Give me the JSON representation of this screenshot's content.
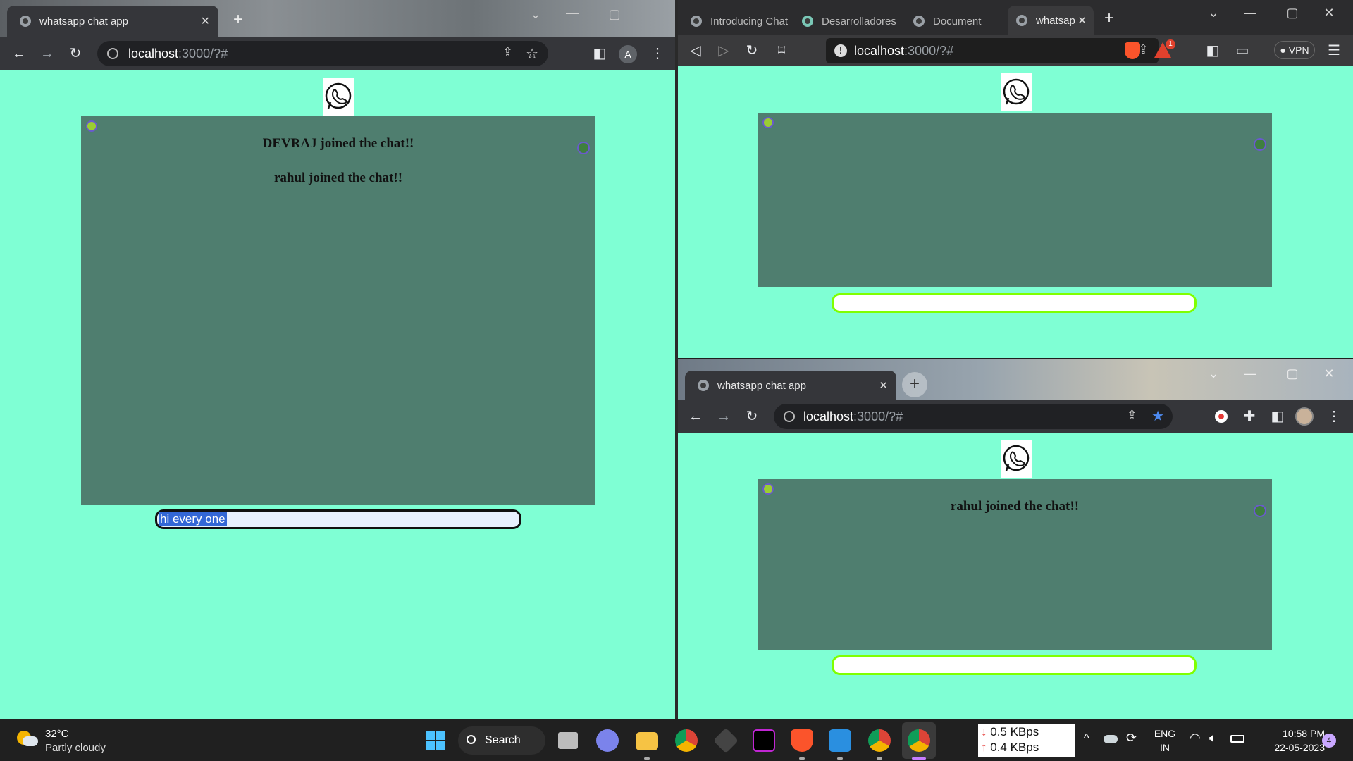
{
  "left_window": {
    "tab_title": "whatsapp chat app",
    "url_host": "localhost",
    "url_path": ":3000/?#",
    "profile_initial": "A",
    "messages": [
      "DEVRAJ joined the chat!!",
      "rahul joined the chat!!"
    ],
    "input_value": "hi every one"
  },
  "right_top_window": {
    "tabs": [
      "Introducing Chat",
      "Desarrolladores",
      "Document",
      "whatsapp chat app"
    ],
    "url_host": "localhost",
    "url_path": ":3000/?#",
    "vpn_label": "VPN",
    "brave_badge": "1",
    "messages": [],
    "input_value": ""
  },
  "right_bottom_window": {
    "tab_title": "whatsapp chat app",
    "url_host": "localhost",
    "url_path": ":3000/?#",
    "messages": [
      "rahul joined the chat!!"
    ],
    "input_value": ""
  },
  "taskbar": {
    "weather_temp": "32°C",
    "weather_desc": "Partly cloudy",
    "search_label": "Search",
    "net_down": "0.5 KBps",
    "net_up": "0.4 KBps",
    "lang_top": "ENG",
    "lang_bottom": "IN",
    "time": "10:58 PM",
    "date": "22-05-2023",
    "notification_count": "4"
  },
  "colors": {
    "page_bg": "#7fffd4",
    "chat_bg": "#4f7e6f",
    "input_border": "#7fff00"
  }
}
